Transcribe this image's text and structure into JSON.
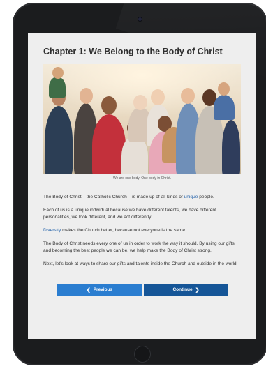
{
  "chapter": {
    "title": "Chapter 1: We Belong to the Body of Christ"
  },
  "image": {
    "caption": "We are one body. One body in Christ."
  },
  "paragraphs": {
    "p1_before": "The Body of Christ – the Catholic Church – is made up of all kinds of ",
    "p1_link": "unique",
    "p1_after": " people.",
    "p2": "Each of us is a unique individual because we have different talents, we have different personalities, we look different, and we act differently.",
    "p3_link": "Diversity",
    "p3_after": " makes the Church better, because not everyone is the same.",
    "p4": "The Body of Christ needs every one of us in order to work the way it should. By using our gifts and becoming the best people we can be, we help make the Body of Christ strong.",
    "p5": "Next, let’s look at ways to share our gifts and talents inside the Church and outside in the world!"
  },
  "nav": {
    "previous_label": "Previous",
    "continue_label": "Continue"
  },
  "icons": {
    "previous": "chevron-left-icon",
    "continue": "chevron-right-icon"
  },
  "colors": {
    "previous_button": "#2a7dd0",
    "continue_button": "#155597",
    "link_text": "#1f5fa8",
    "device_frame": "#1b1c1e"
  }
}
